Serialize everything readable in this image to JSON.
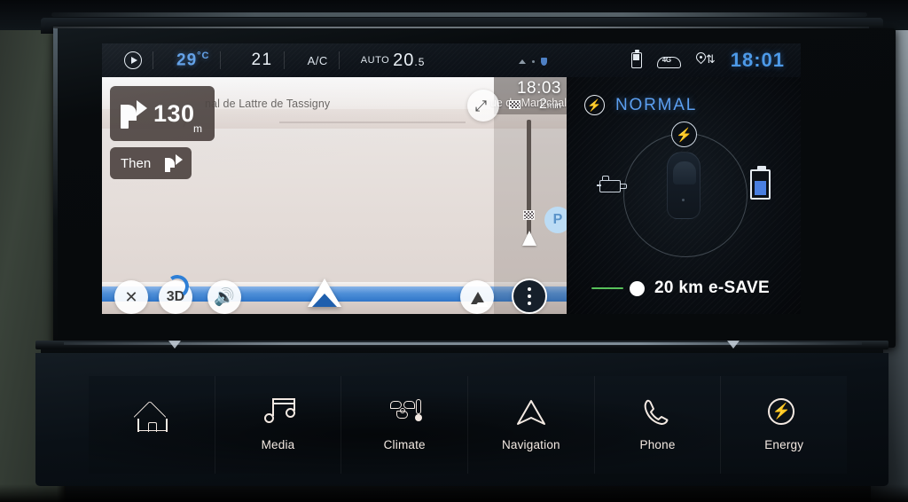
{
  "status_bar": {
    "play_icon": "play-circle-icon",
    "outside_temp": "29",
    "outside_temp_unit": "°C",
    "fan_speed": "21",
    "ac_label": "A/C",
    "auto_label": "AUTO",
    "set_temp": "20",
    "set_temp_decimal": ".5",
    "battery_icon": "battery-icon",
    "network_icon": "4g-connected-car-icon",
    "gps_icon": "gps-location-icon",
    "clock": "18:01"
  },
  "map": {
    "direction": {
      "maneuver_icon": "turn-right-arrow-icon",
      "distance": "130",
      "distance_unit": "m",
      "then_label": "Then",
      "then_maneuver_icon": "turn-right-arrow-icon"
    },
    "street_label_primary": "nal de Lattre de Tassigny",
    "street_label_secondary": "ue du Maréchal",
    "eta": {
      "arrival_time": "18:03",
      "remaining": "2",
      "remaining_unit": "min",
      "flag_icon": "checkered-flag-icon"
    },
    "poi_parking_label": "P",
    "controls": {
      "close_label": "✕",
      "view_3d_label": "3D",
      "volume_icon": "speaker-volume-icon",
      "report_icon": "report-incident-icon",
      "more_icon": "more-options-icon",
      "expand_icon": "expand-fullscreen-icon"
    }
  },
  "energy_panel": {
    "mode_icon": "bolt-circle-icon",
    "mode_label": "NORMAL",
    "flow_bolt_icon": "bolt-circle-icon",
    "engine_icon": "combustion-engine-icon",
    "car_icon": "car-top-view-icon",
    "battery_icon": "battery-charge-icon",
    "esave": {
      "slider_icon": "slider-knob",
      "label": "20 km e-SAVE",
      "accent_color": "#57c05a"
    }
  },
  "bottom_nav": {
    "items": [
      {
        "id": "home",
        "label": "",
        "icon": "home-icon"
      },
      {
        "id": "media",
        "label": "Media",
        "icon": "music-note-icon"
      },
      {
        "id": "climate",
        "label": "Climate",
        "icon": "fan-thermometer-icon"
      },
      {
        "id": "navigation",
        "label": "Navigation",
        "icon": "navigation-arrow-icon"
      },
      {
        "id": "phone",
        "label": "Phone",
        "icon": "phone-handset-icon"
      },
      {
        "id": "energy",
        "label": "Energy",
        "icon": "bolt-circle-icon"
      }
    ]
  },
  "colors": {
    "accent_blue": "#4d9ae8",
    "mode_blue": "#5c9ff0",
    "route_blue": "#2f76c9",
    "esave_green": "#57c05a",
    "panel_bg": "#0a0e13"
  }
}
